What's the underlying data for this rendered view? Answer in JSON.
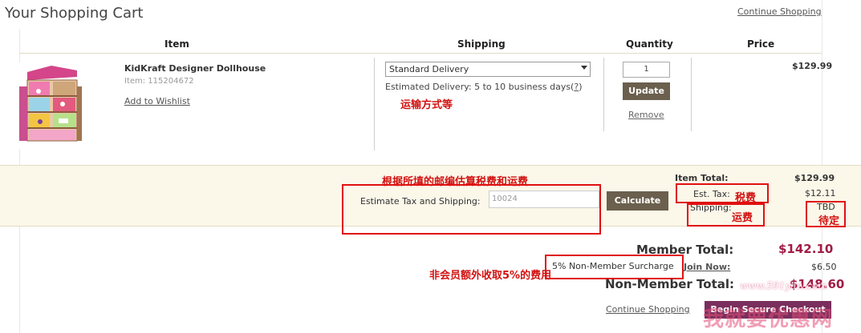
{
  "header": {
    "title": "Your Shopping Cart",
    "continue_shopping": "Continue Shopping"
  },
  "columns": {
    "item": "Item",
    "shipping": "Shipping",
    "quantity": "Quantity",
    "price": "Price"
  },
  "product": {
    "name": "KidKraft Designer Dollhouse",
    "item_number": "Item: 115204672",
    "add_to_wishlist": "Add to Wishlist",
    "shipping_method": "Standard Delivery",
    "estimated_delivery": "Estimated Delivery: 5 to 10 business days(",
    "help_mark": "?",
    "estimated_delivery_close": ")",
    "quantity": "1",
    "update_label": "Update",
    "remove_label": "Remove",
    "price": "$129.99"
  },
  "estimate": {
    "label": "Estimate Tax and Shipping:",
    "zip_value": "10024",
    "calculate_label": "Calculate"
  },
  "summary": {
    "item_total_label": "Item Total:",
    "item_total_value": "$129.99",
    "est_tax_label": "Est. Tax:",
    "est_tax_value": "$12.11",
    "shipping_label": "Shipping:",
    "shipping_value": "TBD",
    "member_total_label": "Member Total:",
    "member_total_value": "$142.10",
    "surcharge_label": "5% Non-Member Surcharge",
    "join_now": "Join Now:",
    "surcharge_value": "$6.50",
    "nonmember_total_label": "Non-Member Total:",
    "nonmember_total_value": "$148.60",
    "continue_shopping": "Continue Shopping",
    "checkout_label": "Begin Secure Checkout"
  },
  "annotations": {
    "shipping_methods": "运输方式等",
    "estimate_note": "根据所填的邮编估算税费和运费",
    "tax": "税费",
    "shipping_fee": "运费",
    "pending": "待定",
    "surcharge_note": "非会员额外收取5%的费用"
  },
  "watermark": {
    "url": "www.591yhw.com",
    "site": "我就要优惠网"
  },
  "colors": {
    "annotation_red": "#d21111",
    "price_accent": "#a01c45",
    "button_dark": "#6b5f4d",
    "checkout_button": "#7a2f5d",
    "cream_panel": "#fbf7e9"
  }
}
